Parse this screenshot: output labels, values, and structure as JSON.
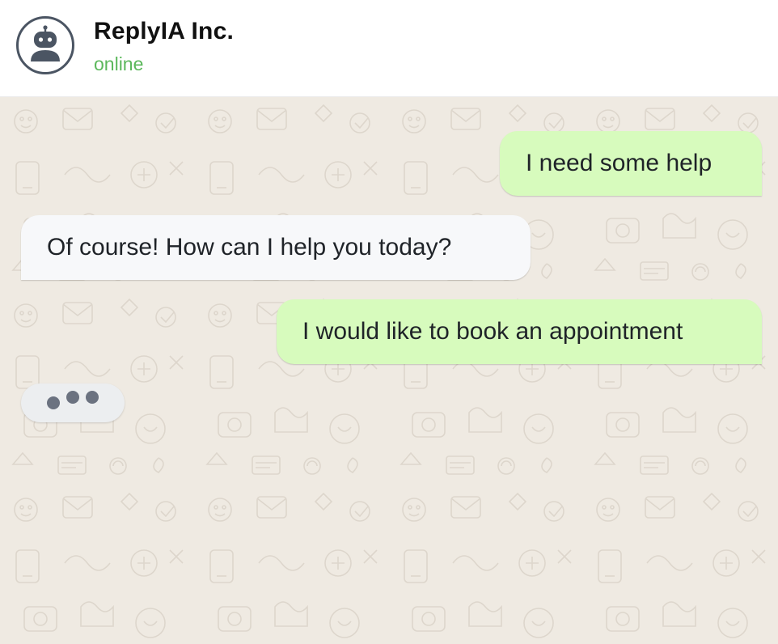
{
  "header": {
    "avatar_icon": "robot-icon",
    "name": "ReplyIA Inc.",
    "status": "online"
  },
  "messages": [
    {
      "direction": "outgoing",
      "text": "I need some help"
    },
    {
      "direction": "incoming",
      "text": "Of course! How can I help you today?"
    },
    {
      "direction": "outgoing",
      "text": "I would like to book an appointment"
    }
  ],
  "typing_indicator": {
    "icon": "typing-dots-icon",
    "direction": "incoming"
  },
  "colors": {
    "status_online": "#5cb85c",
    "outgoing_bubble": "#d7fbbd",
    "incoming_bubble": "#f7f8fa",
    "chat_background": "#efeae2"
  }
}
